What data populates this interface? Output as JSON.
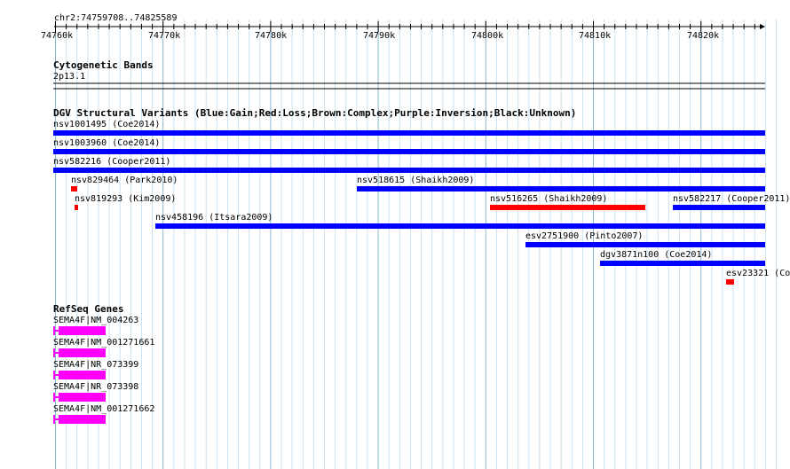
{
  "ruler": {
    "locus": "chr2:74759708..74825589",
    "ticks": [
      "74760k",
      "74770k",
      "74780k",
      "74790k",
      "74800k",
      "74810k",
      "74820k"
    ]
  },
  "cytobands": {
    "title": "Cytogenetic Bands",
    "band": "2p13.1"
  },
  "dgv": {
    "title": "DGV Structural Variants (Blue:Gain;Red:Loss;Brown:Complex;Purple:Inversion;Black:Unknown)",
    "colors": {
      "gain": "#0000ff",
      "loss": "#ff0000"
    },
    "variants": [
      {
        "label": "nsv1001495 (Coe2014)",
        "type": "gain"
      },
      {
        "label": "nsv1003960 (Coe2014)",
        "type": "gain"
      },
      {
        "label": "nsv582216 (Cooper2011)",
        "type": "gain"
      },
      {
        "label": "nsv829464 (Park2010)",
        "type": "loss"
      },
      {
        "label": "nsv518615 (Shaikh2009)",
        "type": "gain"
      },
      {
        "label": "nsv819293 (Kim2009)",
        "type": "loss"
      },
      {
        "label": "nsv516265 (Shaikh2009)",
        "type": "loss"
      },
      {
        "label": "nsv582217 (Cooper2011)",
        "type": "gain"
      },
      {
        "label": "nsv458196 (Itsara2009)",
        "type": "gain"
      },
      {
        "label": "esv2751900 (Pinto2007)",
        "type": "gain"
      },
      {
        "label": "dgv3871n100 (Coe2014)",
        "type": "gain"
      },
      {
        "label": "esv23321 (Co",
        "type": "loss"
      }
    ]
  },
  "refseq": {
    "title": "RefSeq Genes",
    "color": "#ff00ff",
    "genes": [
      {
        "label": "SEMA4F|NM_004263"
      },
      {
        "label": "SEMA4F|NM_001271661"
      },
      {
        "label": "SEMA4F|NR_073399"
      },
      {
        "label": "SEMA4F|NR_073398"
      },
      {
        "label": "SEMA4F|NM_001271662"
      }
    ]
  }
}
